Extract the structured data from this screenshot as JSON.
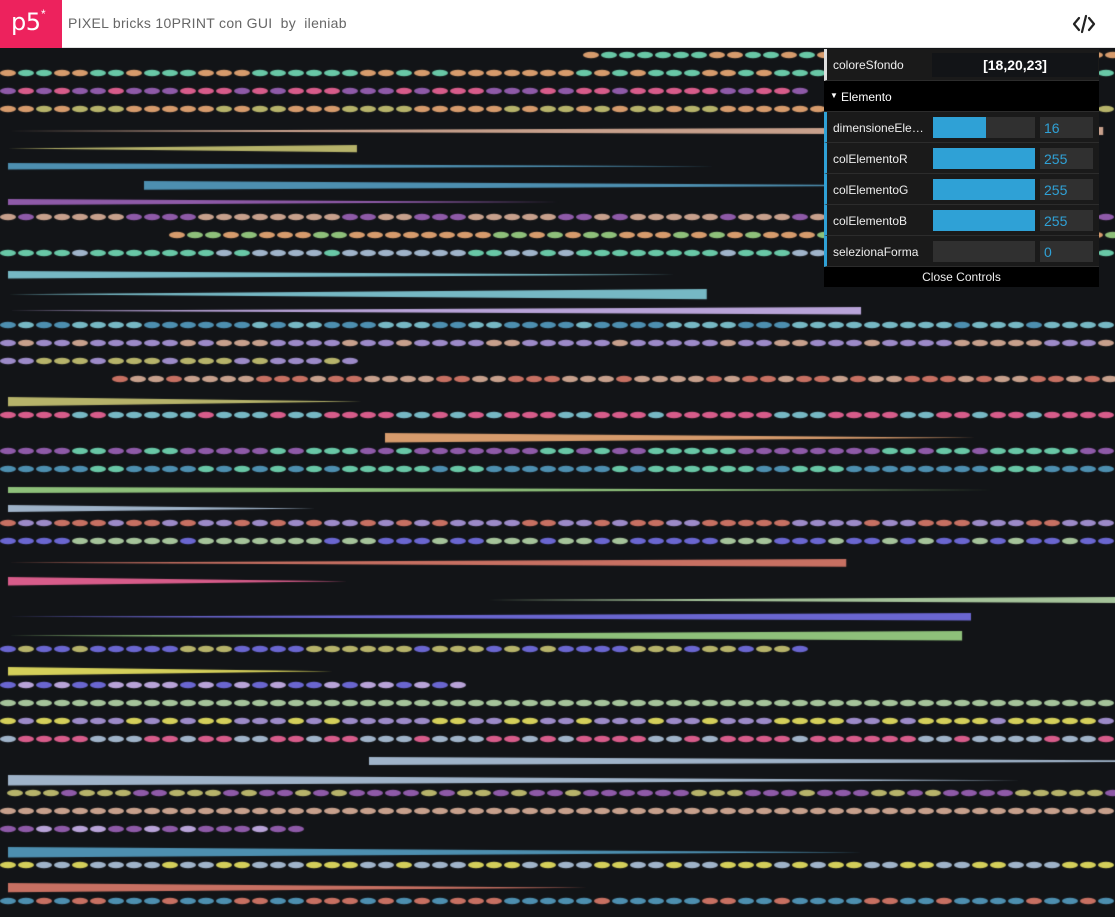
{
  "header": {
    "logo_text": "p5",
    "logo_mark": "*",
    "sketch_title": "PIXEL bricks 10PRINT con GUI",
    "by_label": "by",
    "author": "ileniab",
    "code_icon": "code-brackets-icon"
  },
  "gui": {
    "coloreSfondo": {
      "label": "coloreSfondo",
      "value": "[18,20,23]"
    },
    "folder": {
      "label": "Elemento",
      "expanded": true
    },
    "controls": [
      {
        "label": "dimensioneElemento",
        "value": "16",
        "fraction": 0.52
      },
      {
        "label": "colElementoR",
        "value": "255",
        "fraction": 1.0
      },
      {
        "label": "colElementoG",
        "value": "255",
        "fraction": 1.0
      },
      {
        "label": "colElementoB",
        "value": "255",
        "fraction": 1.0
      },
      {
        "label": "selezionaForma",
        "value": "0",
        "fraction": 0.0
      }
    ],
    "close_label": "Close Controls"
  },
  "colors": {
    "brand": "#ed225d",
    "canvas_bg": "#121417",
    "slider_fill": "#2fa1d6"
  }
}
